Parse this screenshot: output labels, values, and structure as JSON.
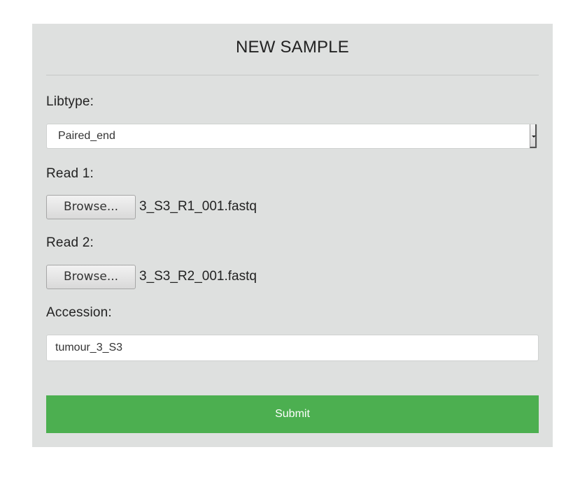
{
  "form": {
    "title": "NEW SAMPLE",
    "libtype": {
      "label": "Libtype:",
      "selected": "Paired_end"
    },
    "read1": {
      "label": "Read 1:",
      "browse_label": "Browse...",
      "filename": "3_S3_R1_001.fastq"
    },
    "read2": {
      "label": "Read 2:",
      "browse_label": "Browse...",
      "filename": "3_S3_R2_001.fastq"
    },
    "accession": {
      "label": "Accession:",
      "value": "tumour_3_S3"
    },
    "submit_label": "Submit"
  },
  "colors": {
    "panel_bg": "#dee0df",
    "submit_bg": "#4caf50",
    "submit_text": "#ffffff"
  },
  "icons": {
    "select_arrow": "chevron-down-icon"
  }
}
